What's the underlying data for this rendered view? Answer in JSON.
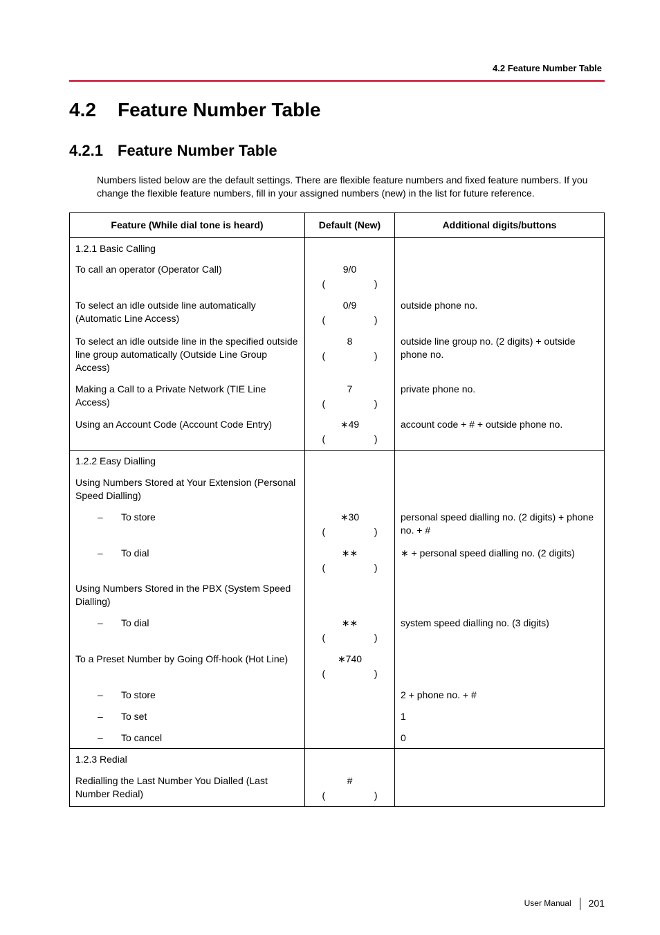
{
  "header": {
    "topRight": "4.2 Feature Number Table"
  },
  "titles": {
    "sectionNum": "4.2",
    "sectionTitle": "Feature Number Table",
    "subsectionNum": "4.2.1",
    "subsectionTitle": "Feature Number Table"
  },
  "intro": "Numbers listed below are the default settings. There are flexible feature numbers and fixed feature numbers. If you change the flexible feature numbers, fill in your assigned numbers (new) in the list for future reference.",
  "tableHeaders": {
    "feature": "Feature (While dial tone is heard)",
    "default": "Default (New)",
    "additional": "Additional digits/buttons"
  },
  "glyphs": {
    "star": "∗",
    "dash": "–"
  },
  "groups": [
    {
      "heading": "1.2.1 Basic Calling",
      "rows": [
        {
          "feature": "To call an operator (Operator Call)",
          "default": "9/0",
          "paren": true,
          "additional": ""
        },
        {
          "feature": "To select an idle outside line automatically (Automatic Line Access)",
          "default": "0/9",
          "paren": true,
          "additional": "outside phone no."
        },
        {
          "feature": "To select an idle outside line in the specified outside line group automatically (Outside Line Group Access)",
          "default": "8",
          "paren": true,
          "additional": "outside line group no. (2 digits) + outside phone no."
        },
        {
          "feature": "Making a Call to a Private Network (TIE Line Access)",
          "default": "7",
          "paren": true,
          "additional": "private phone no."
        },
        {
          "feature": "Using an Account Code (Account Code Entry)",
          "default": "∗49",
          "paren": true,
          "additional": "account code + # + outside phone no."
        }
      ]
    },
    {
      "heading": "1.2.2 Easy Dialling",
      "rows": [
        {
          "feature": "Using Numbers Stored at Your Extension (Personal Speed Dialling)",
          "default": "",
          "paren": false,
          "additional": ""
        },
        {
          "indent": true,
          "feature": "To store",
          "default": "∗30",
          "paren": true,
          "additional": "personal speed dialling no. (2 digits) + phone no. + #"
        },
        {
          "indent": true,
          "feature": "To dial",
          "default": "∗∗",
          "paren": true,
          "additional": "∗ + personal speed dialling no. (2 digits)"
        },
        {
          "feature": "Using Numbers Stored in the PBX (System Speed Dialling)",
          "default": "",
          "paren": false,
          "additional": ""
        },
        {
          "indent": true,
          "feature": "To dial",
          "default": "∗∗",
          "paren": true,
          "additional": "system speed dialling no. (3 digits)"
        },
        {
          "feature": "To a Preset Number by Going Off-hook (Hot Line)",
          "default": "∗740",
          "paren": true,
          "additional": ""
        },
        {
          "indent": true,
          "feature": "To store",
          "default": "",
          "paren": false,
          "additional": "2 + phone no. + #"
        },
        {
          "indent": true,
          "feature": "To set",
          "default": "",
          "paren": false,
          "additional": "1"
        },
        {
          "indent": true,
          "feature": "To cancel",
          "default": "",
          "paren": false,
          "additional": "0"
        }
      ]
    },
    {
      "heading": "1.2.3 Redial",
      "rows": [
        {
          "feature": "Redialling the Last Number You Dialled (Last Number Redial)",
          "default": "#",
          "paren": true,
          "additional": ""
        }
      ]
    }
  ],
  "footer": {
    "label": "User Manual",
    "page": "201"
  }
}
